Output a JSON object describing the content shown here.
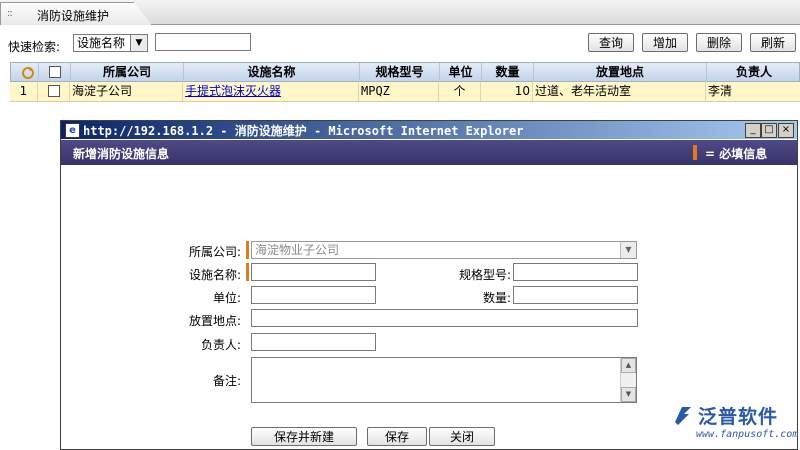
{
  "tab": {
    "title": "消防设施维护",
    "grip": "::"
  },
  "search": {
    "label": "快速检索:",
    "field_selected": "设施名称",
    "query_value": "",
    "buttons": {
      "query": "查询",
      "add": "增加",
      "delete": "删除",
      "refresh": "刷新"
    }
  },
  "table": {
    "columns": {
      "company": "所属公司",
      "facility": "设施名称",
      "model": "规格型号",
      "unit": "单位",
      "quantity": "数量",
      "location": "放置地点",
      "owner": "负责人"
    },
    "rows": [
      {
        "index": "1",
        "company": "海淀子公司",
        "facility": "手提式泡沫灭火器",
        "model": "MPQZ",
        "unit": "个",
        "quantity": "10",
        "location": "过道、老年活动室",
        "owner": "李清"
      }
    ]
  },
  "dialog": {
    "window_title": "http://192.168.1.2 - 消防设施维护 - Microsoft Internet Explorer",
    "header_title": "新增消防设施信息",
    "required_legend": "= 必填信息",
    "form": {
      "company_label": "所属公司:",
      "company_value": "海淀物业子公司",
      "facility_label": "设施名称:",
      "facility_value": "",
      "model_label": "规格型号:",
      "model_value": "",
      "unit_label": "单位:",
      "unit_value": "",
      "quantity_label": "数量:",
      "quantity_value": "",
      "location_label": "放置地点:",
      "location_value": "",
      "owner_label": "负责人:",
      "owner_value": "",
      "notes_label": "备注:",
      "notes_value": ""
    },
    "buttons": {
      "save_new": "保存并新建",
      "save": "保存",
      "close": "关闭"
    }
  },
  "watermark": {
    "brand": "泛普软件",
    "url": "www.fanpusoft.com"
  },
  "colors": {
    "required": "#e07a1a",
    "dialog_header": "#37336a",
    "titlebar": "#0a246a",
    "row_highlight": "#fff7c9"
  }
}
